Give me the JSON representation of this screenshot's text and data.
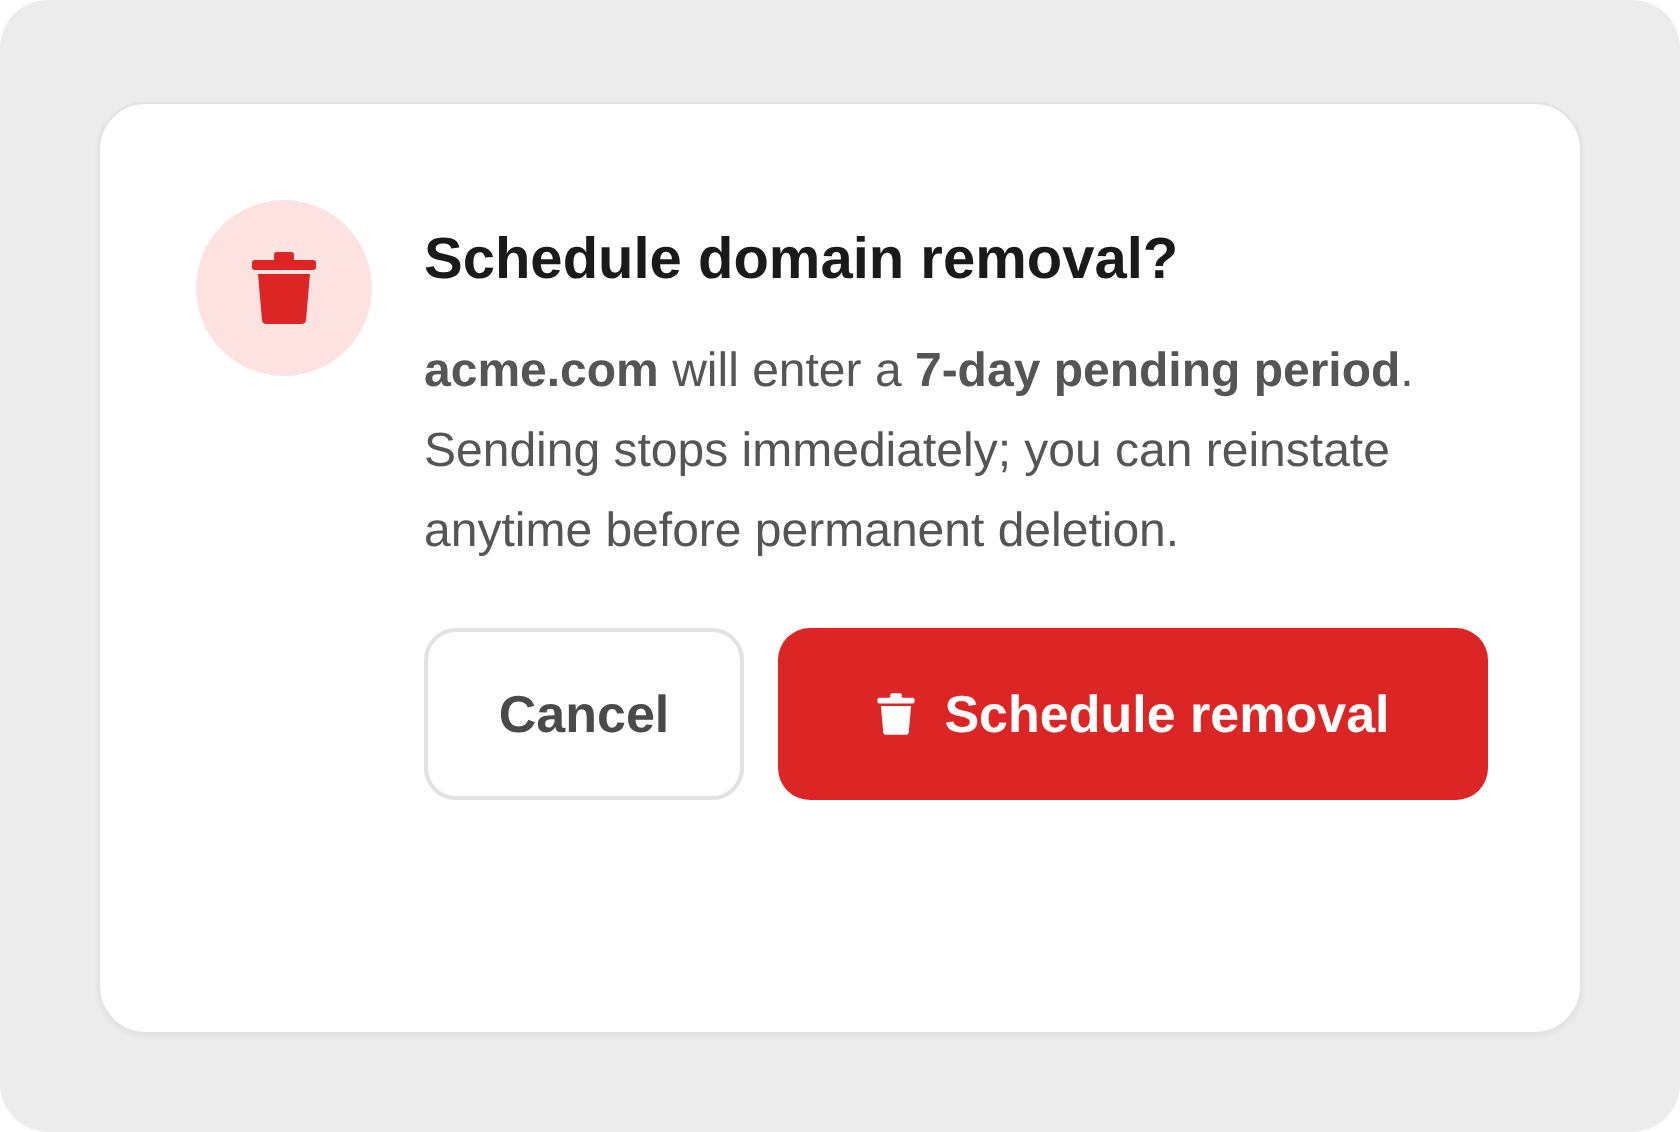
{
  "dialog": {
    "title": "Schedule domain removal?",
    "message": "**acme.com** will enter a **7-day pending period**. Sending stops immediately; you can reinstate anytime before permanent deletion.",
    "buttons": [
      {
        "label": "Cancel",
        "kind": "secondary"
      },
      {
        "label": "Schedule removal",
        "kind": "danger"
      }
    ]
  }
}
